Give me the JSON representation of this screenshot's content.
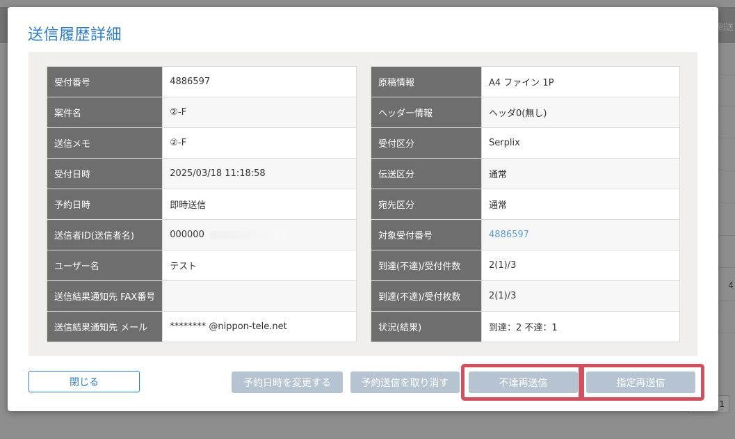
{
  "background": {
    "right_header_text": "到送",
    "right_number": "4",
    "pager_text": "1"
  },
  "modal": {
    "title": "送信履歴詳細",
    "left_rows": [
      {
        "label": "受付番号",
        "value": "4886597"
      },
      {
        "label": "案件名",
        "value": "②-F"
      },
      {
        "label": "送信メモ",
        "value": "②-F"
      },
      {
        "label": "受付日時",
        "value": "2025/03/18 11:18:58"
      },
      {
        "label": "予約日時",
        "value": "即時送信"
      },
      {
        "label": "送信者ID(送信者名)",
        "value": "000000"
      },
      {
        "label": "ユーザー名",
        "value": "テスト"
      },
      {
        "label": "送信結果通知先 FAX番号",
        "value": ""
      },
      {
        "label": "送信結果通知先 メール",
        "value": "********    @nippon-tele.net"
      }
    ],
    "right_rows": [
      {
        "label": "原稿情報",
        "value": "A4 ファイン 1P"
      },
      {
        "label": "ヘッダー情報",
        "value": "ヘッダ0(無し)"
      },
      {
        "label": "受付区分",
        "value": "Serplix"
      },
      {
        "label": "伝送区分",
        "value": "通常"
      },
      {
        "label": "宛先区分",
        "value": "通常"
      },
      {
        "label": "対象受付番号",
        "value": "4886597"
      },
      {
        "label": "到達(不達)/受付件数",
        "value": "2(1)/3"
      },
      {
        "label": "到達(不達)/受付枚数",
        "value": "2(1)/3"
      },
      {
        "label": "状況(結果)",
        "value": "到達：2 不達：1"
      }
    ],
    "buttons": {
      "close": "閉じる",
      "change_reservation": "予約日時を変更する",
      "cancel_reservation": "予約送信を取り消す",
      "resend_failed": "不達再送信",
      "resend_specified": "指定再送信"
    }
  },
  "colors": {
    "title": "#2d7dc6",
    "label_bg": "#6e6e6e",
    "disabled_button": "#b6c4d2",
    "highlight": "#d05060",
    "link": "#5b9bd0"
  }
}
